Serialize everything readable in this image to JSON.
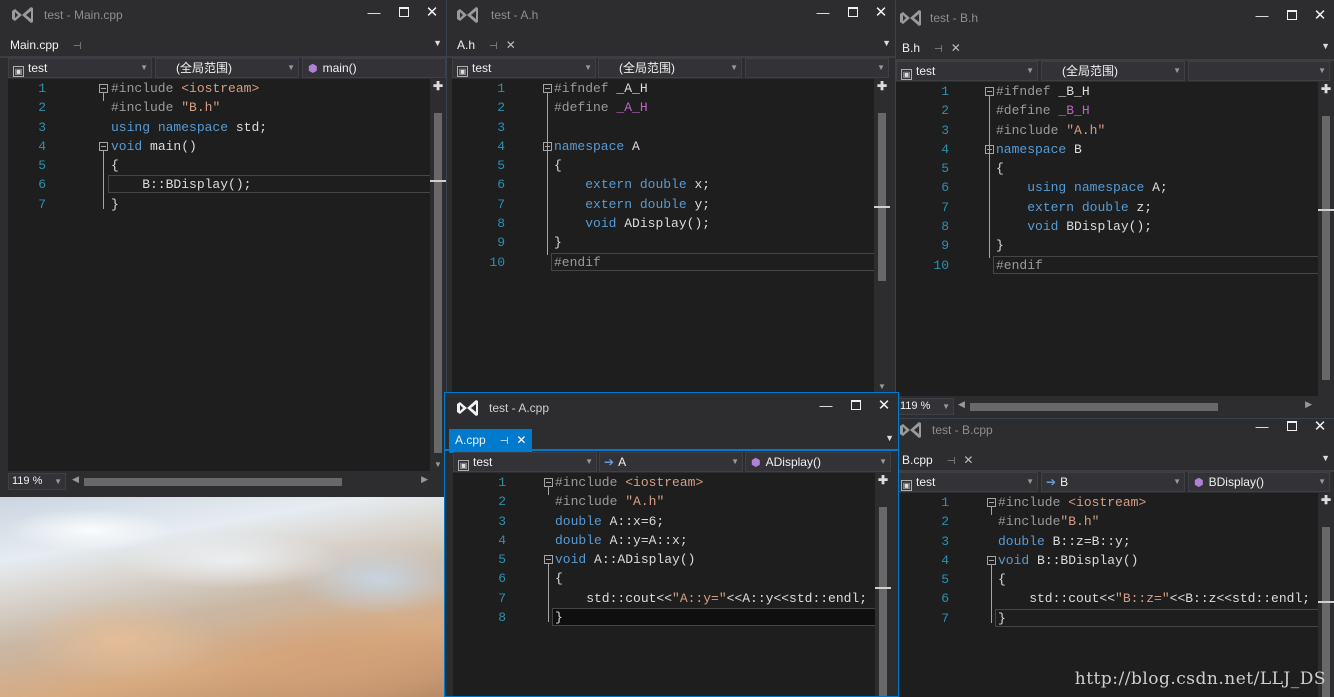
{
  "windows": {
    "main": {
      "title": "test - Main.cpp",
      "tab": "Main.cpp",
      "project": "test",
      "scope": "(全局范围)",
      "member": "main()",
      "zoom": "119 %",
      "lines": [
        "1",
        "2",
        "3",
        "4",
        "5",
        "6",
        "7"
      ]
    },
    "a_h": {
      "title": "test - A.h",
      "tab": "A.h",
      "project": "test",
      "scope": "(全局范围)",
      "member": "",
      "lines": [
        "1",
        "2",
        "3",
        "4",
        "5",
        "6",
        "7",
        "8",
        "9",
        "10"
      ]
    },
    "b_h": {
      "title": "test - B.h",
      "tab": "B.h",
      "project": "test",
      "scope": "(全局范围)",
      "member": "",
      "zoom": "119 %",
      "lines": [
        "1",
        "2",
        "3",
        "4",
        "5",
        "6",
        "7",
        "8",
        "9",
        "10"
      ]
    },
    "a_cpp": {
      "title": "test - A.cpp",
      "tab": "A.cpp",
      "project": "test",
      "scope": "A",
      "member": "ADisplay()",
      "lines": [
        "1",
        "2",
        "3",
        "4",
        "5",
        "6",
        "7",
        "8"
      ]
    },
    "b_cpp": {
      "title": "test - B.cpp",
      "tab": "B.cpp",
      "project": "test",
      "scope": "B",
      "member": "BDisplay()",
      "lines": [
        "1",
        "2",
        "3",
        "4",
        "5",
        "6",
        "7"
      ]
    }
  },
  "watermark": "http://blog.csdn.net/LLJ_DS",
  "colors": {
    "keyword": "#569cd6",
    "string": "#d69d85",
    "macro": "#bd63c5",
    "accent": "#007acc",
    "background": "#1e1e1e"
  },
  "icons": [
    "vs-logo-icon",
    "pin-icon",
    "close-icon",
    "minimize-icon",
    "maximize-icon",
    "project-icon",
    "arrow-icon",
    "method-cube-icon",
    "split-editor-icon",
    "chevron-down-icon"
  ]
}
